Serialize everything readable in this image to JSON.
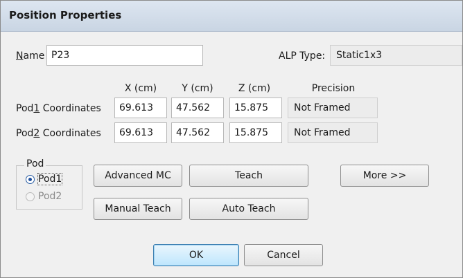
{
  "window": {
    "title": "Position Properties"
  },
  "name_row": {
    "label_underlined": "N",
    "label_rest": "ame",
    "value": "P23",
    "alp_type_label": "ALP Type:",
    "alp_type_value": "Static1x3"
  },
  "coordinates": {
    "headers": {
      "x": "X (cm)",
      "y": "Y (cm)",
      "z": "Z (cm)",
      "precision": "Precision"
    },
    "rows": [
      {
        "label_pre": "Pod",
        "label_ul": "1",
        "label_post": " Coordinates",
        "x": "69.613",
        "y": "47.562",
        "z": "15.875",
        "precision": "Not Framed"
      },
      {
        "label_pre": "Pod",
        "label_ul": "2",
        "label_post": " Coordinates",
        "x": "69.613",
        "y": "47.562",
        "z": "15.875",
        "precision": "Not Framed"
      }
    ]
  },
  "pod_group": {
    "label": "Pod",
    "options": [
      {
        "label": "Pod1",
        "checked": true,
        "enabled": true
      },
      {
        "label": "Pod2",
        "checked": false,
        "enabled": false
      }
    ]
  },
  "buttons": {
    "advanced_mc": "Advanced MC",
    "teach": "Teach",
    "more": "More >>",
    "manual_teach": "Manual Teach",
    "auto_teach": "Auto Teach",
    "ok": "OK",
    "cancel": "Cancel"
  }
}
